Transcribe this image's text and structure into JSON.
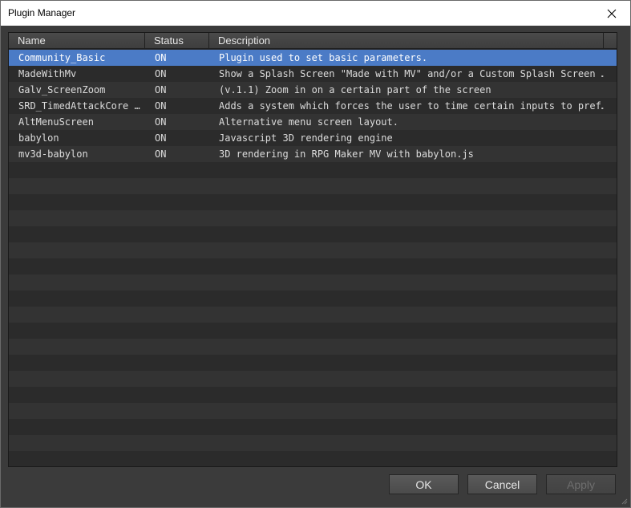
{
  "window": {
    "title": "Plugin Manager"
  },
  "columns": {
    "name": "Name",
    "status": "Status",
    "description": "Description"
  },
  "plugins": [
    {
      "name": "Community_Basic",
      "status": "ON",
      "description": "Plugin used to set basic parameters."
    },
    {
      "name": "MadeWithMv",
      "status": "ON",
      "description": "Show a Splash Screen \"Made with MV\" and/or a Custom Splash Screen …"
    },
    {
      "name": "Galv_ScreenZoom",
      "status": "ON",
      "description": "(v.1.1) Zoom in on a certain part of the screen"
    },
    {
      "name": "SRD_TimedAttackCore …",
      "status": "ON",
      "description": "Adds a system which forces the user to time certain inputs to pref…"
    },
    {
      "name": "AltMenuScreen",
      "status": "ON",
      "description": "Alternative menu screen layout."
    },
    {
      "name": "babylon",
      "status": "ON",
      "description": "Javascript 3D rendering engine"
    },
    {
      "name": "mv3d-babylon",
      "status": "ON",
      "description": "3D rendering in RPG Maker MV with babylon.js"
    }
  ],
  "buttons": {
    "ok": "OK",
    "cancel": "Cancel",
    "apply": "Apply"
  },
  "colors": {
    "selection": "#4b7bc6",
    "background": "#3b3b3b"
  }
}
